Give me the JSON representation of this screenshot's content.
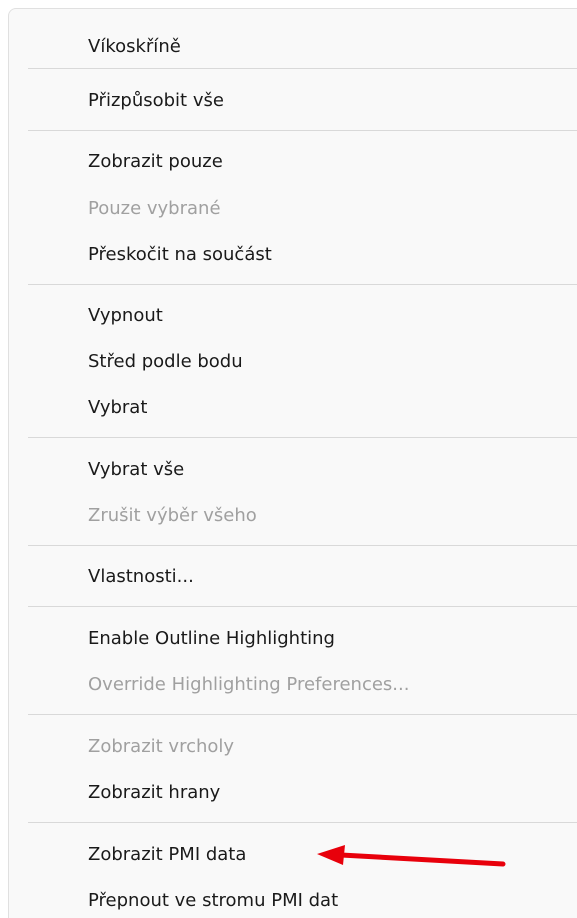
{
  "context_menu": {
    "items": [
      {
        "label": "Víkoskříně",
        "enabled": true
      },
      {
        "label": "Přizpůsobit vše",
        "enabled": true
      },
      {
        "label": "Zobrazit pouze",
        "enabled": true
      },
      {
        "label": "Pouze vybrané",
        "enabled": false
      },
      {
        "label": "Přeskočit na součást",
        "enabled": true
      },
      {
        "label": "Vypnout",
        "enabled": true
      },
      {
        "label": "Střed podle bodu",
        "enabled": true
      },
      {
        "label": "Vybrat",
        "enabled": true
      },
      {
        "label": "Vybrat vše",
        "enabled": true
      },
      {
        "label": "Zrušit výběr všeho",
        "enabled": false
      },
      {
        "label": "Vlastnosti...",
        "enabled": true
      },
      {
        "label": "Enable Outline Highlighting",
        "enabled": true
      },
      {
        "label": "Override Highlighting Preferences...",
        "enabled": false
      },
      {
        "label": "Zobrazit vrcholy",
        "enabled": false
      },
      {
        "label": "Zobrazit hrany",
        "enabled": true
      },
      {
        "label": "Zobrazit PMI data",
        "enabled": true
      },
      {
        "label": "Přepnout ve stromu PMI dat",
        "enabled": true
      }
    ]
  },
  "colors": {
    "menu_background": "#f9f9f9",
    "text": "#1a1a1a",
    "disabled_text": "#a0a0a0",
    "separator": "#d9d9d9",
    "annotation_arrow": "#e8000b"
  }
}
